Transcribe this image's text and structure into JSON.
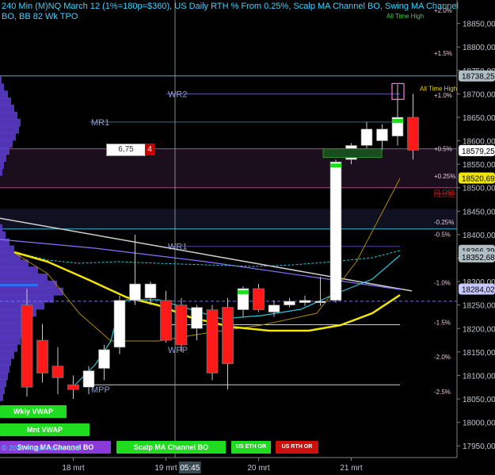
{
  "header": {
    "title": "240 Min (M)NQ March 12 (1%=180p=$360), US Daily RTH % From 0.25%, Scalp MA Channel BO, Swing MA Channel BO, BB 82 Wk TPO",
    "copyright": "© 2023 NinjaTrader, LLC"
  },
  "order": {
    "qty_value": "6,75",
    "qty_flag": "4"
  },
  "buttons": {
    "wkly_vwap": "Wkly VWAP",
    "mnt_vwap": "Mnt VWAP",
    "swing_ma": "Swing MA Channel BO",
    "scalp_ma": "Scalp MA Channel BO",
    "us_eth_or": "US ETH OR",
    "us_rth_or": "US RTH OR"
  },
  "colors": {
    "up": "#ffffff",
    "down": "#ff1a1a",
    "accent": "#3fd2ff",
    "yellow_ma": "#f2e600",
    "cyan_band": "#27c6d8"
  },
  "chart_data": {
    "type": "candlestick",
    "y_axis": {
      "min": 17925,
      "max": 18900,
      "ticks": [
        17950,
        18000,
        18050,
        18100,
        18150,
        18200,
        18250,
        18300,
        18350,
        18400,
        18450,
        18500,
        18550,
        18600,
        18650,
        18700,
        18750,
        18800,
        18850
      ],
      "tick_labels": [
        "17950,00",
        "18000,00",
        "18050,00",
        "18100,00",
        "18150,00",
        "18200,00",
        "18250,00",
        "18300,00",
        "18350,00",
        "18400,00",
        "18450,00",
        "18500,00",
        "18550,00",
        "18600,00",
        "18650,00",
        "18700,00",
        "18750,00",
        "18800,00",
        "18850,00"
      ]
    },
    "x_axis": {
      "labels": [
        {
          "label": "18 mrt",
          "bar": 3
        },
        {
          "label": "19 mrt",
          "bar": 9
        },
        {
          "label": "20 mrt",
          "bar": 15
        },
        {
          "label": "21 mrt",
          "bar": 21
        }
      ],
      "crosshair_label": "05:45",
      "crosshair_bar": 10.5
    },
    "candles": [
      {
        "o": 18250,
        "h": 18285,
        "l": 18055,
        "c": 18075
      },
      {
        "o": 18175,
        "h": 18210,
        "l": 18085,
        "c": 18105
      },
      {
        "o": 18120,
        "h": 18160,
        "l": 18060,
        "c": 18095
      },
      {
        "o": 18080,
        "h": 18100,
        "l": 18050,
        "c": 18070
      },
      {
        "o": 18075,
        "h": 18120,
        "l": 18060,
        "c": 18110
      },
      {
        "o": 18115,
        "h": 18165,
        "l": 18090,
        "c": 18155
      },
      {
        "o": 18160,
        "h": 18270,
        "l": 18145,
        "c": 18260
      },
      {
        "o": 18260,
        "h": 18400,
        "l": 18250,
        "c": 18295
      },
      {
        "o": 18265,
        "h": 18300,
        "l": 18250,
        "c": 18295
      },
      {
        "o": 18260,
        "h": 18280,
        "l": 18170,
        "c": 18175
      },
      {
        "o": 18250,
        "h": 18265,
        "l": 18150,
        "c": 18165
      },
      {
        "o": 18200,
        "h": 18250,
        "l": 18175,
        "c": 18245
      },
      {
        "o": 18240,
        "h": 18250,
        "l": 18090,
        "c": 18105
      },
      {
        "o": 18245,
        "h": 18265,
        "l": 18070,
        "c": 18125
      },
      {
        "o": 18240,
        "h": 18290,
        "l": 18225,
        "c": 18285
      },
      {
        "o": 18285,
        "h": 18295,
        "l": 18235,
        "c": 18240
      },
      {
        "o": 18235,
        "h": 18260,
        "l": 18225,
        "c": 18250
      },
      {
        "o": 18250,
        "h": 18265,
        "l": 18245,
        "c": 18258
      },
      {
        "o": 18255,
        "h": 18270,
        "l": 18248,
        "c": 18260
      },
      {
        "o": 18255,
        "h": 18310,
        "l": 18248,
        "c": 18258
      },
      {
        "o": 18260,
        "h": 18560,
        "l": 18255,
        "c": 18555
      },
      {
        "o": 18560,
        "h": 18595,
        "l": 18550,
        "c": 18590
      },
      {
        "o": 18590,
        "h": 18640,
        "l": 18580,
        "c": 18625
      },
      {
        "o": 18600,
        "h": 18635,
        "l": 18580,
        "c": 18625
      },
      {
        "o": 18610,
        "h": 18720,
        "l": 18590,
        "c": 18650
      },
      {
        "o": 18650,
        "h": 18700,
        "l": 18560,
        "c": 18580
      }
    ],
    "price_markers": [
      {
        "label": "18738,25",
        "value": 18738.25,
        "color": "#b0bec5"
      },
      {
        "label": "18579,25",
        "value": 18579.25,
        "color": "#ffffff"
      },
      {
        "label": "18520,69",
        "value": 18520.69,
        "color": "#f2e600"
      },
      {
        "label": "18366,39",
        "value": 18366.39,
        "color": "#b0bec5"
      },
      {
        "label": "18352,68",
        "value": 18352.68,
        "color": "#b0bec5"
      },
      {
        "label": "18284,02",
        "value": 18284.02,
        "color": "#c8c8ff"
      }
    ],
    "percent_levels": [
      {
        "label": "+2.0%",
        "value": 18878
      },
      {
        "label": "+1.5%",
        "value": 18787
      },
      {
        "label": "+1.0%",
        "value": 18697
      },
      {
        "label": "+0.5%",
        "value": 18583
      },
      {
        "label": "+0.25%",
        "value": 18525
      },
      {
        "label": "CLOSE",
        "value": 18491
      },
      {
        "label": "-0.25%",
        "value": 18427
      },
      {
        "label": "-0.5%",
        "value": 18401
      },
      {
        "label": "-1.0%",
        "value": 18298
      },
      {
        "label": "-1.5%",
        "value": 18213
      },
      {
        "label": "-2.0%",
        "value": 18140
      },
      {
        "label": "-2.5%",
        "value": 18065
      }
    ],
    "annotations": [
      {
        "label": "WR2",
        "value": 18700
      },
      {
        "label": "MR1",
        "value": 18640
      },
      {
        "label": "WR1",
        "value": 18375
      },
      {
        "label": "WPP",
        "value": 18155
      },
      {
        "label": "MPP",
        "value": 18070
      },
      {
        "label": "All Time High",
        "value": 18712
      },
      {
        "label": "All Time High",
        "value": 18866
      }
    ]
  }
}
